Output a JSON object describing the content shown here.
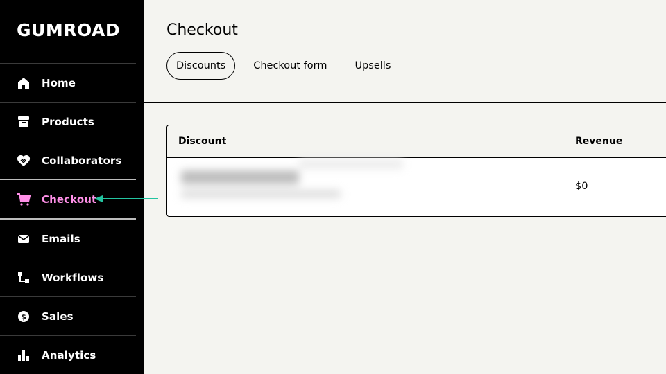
{
  "app": {
    "brand": "GUMROAD"
  },
  "sidebar": {
    "items": [
      {
        "label": "Home",
        "icon": "home-icon"
      },
      {
        "label": "Products",
        "icon": "archive-icon"
      },
      {
        "label": "Collaborators",
        "icon": "handshake-icon"
      },
      {
        "label": "Checkout",
        "icon": "cart-icon",
        "active": true
      },
      {
        "label": "Emails",
        "icon": "envelope-icon"
      },
      {
        "label": "Workflows",
        "icon": "workflow-icon"
      },
      {
        "label": "Sales",
        "icon": "dollar-circle-icon"
      },
      {
        "label": "Analytics",
        "icon": "bar-chart-icon"
      }
    ]
  },
  "main": {
    "title": "Checkout",
    "tabs": [
      {
        "label": "Discounts",
        "active": true
      },
      {
        "label": "Checkout form"
      },
      {
        "label": "Upsells"
      }
    ],
    "table": {
      "columns": [
        "Discount",
        "Revenue"
      ],
      "rows": [
        {
          "discount": "",
          "revenue": "$0"
        }
      ]
    }
  },
  "colors": {
    "sidebar_bg": "#000000",
    "active_pink": "#ff90e8",
    "arrow_teal": "#23c4a0",
    "page_bg": "#f4f4f0"
  }
}
